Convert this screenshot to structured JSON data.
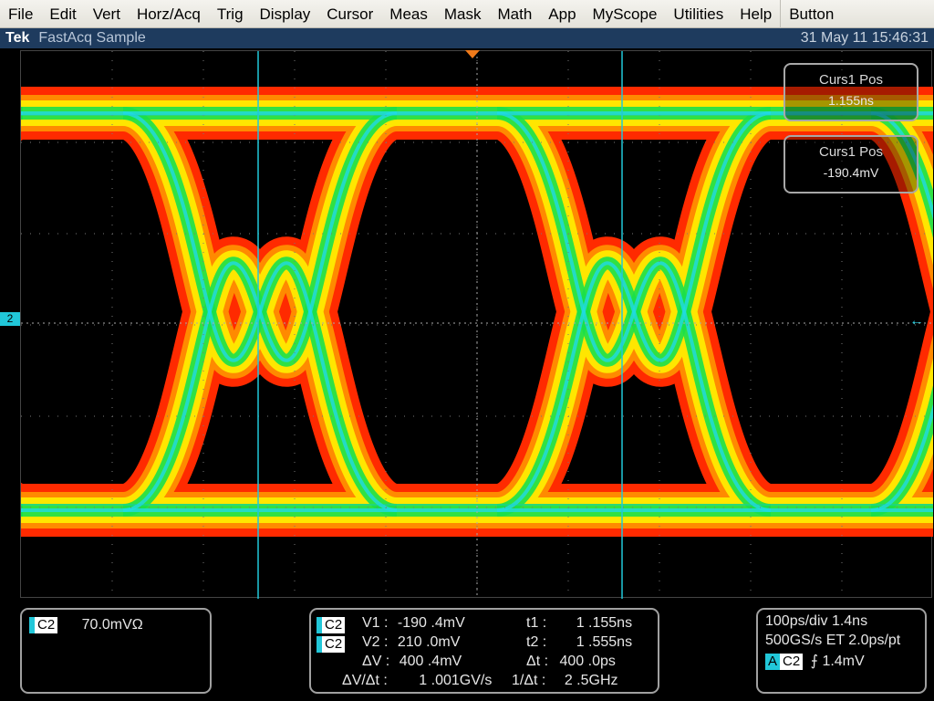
{
  "menubar": {
    "items": [
      "File",
      "Edit",
      "Vert",
      "Horz/Acq",
      "Trig",
      "Display",
      "Cursor",
      "Meas",
      "Mask",
      "Math",
      "App",
      "MyScope",
      "Utilities",
      "Help",
      "Button"
    ]
  },
  "titlebar": {
    "brand": "Tek",
    "title": "FastAcq Sample",
    "timestamp": "31 May 11 15:46:31"
  },
  "display": {
    "channel_marker": "2",
    "colors": {
      "trace_hot": "#ff2a00",
      "trace_mid": "#ffe600",
      "trace_cool": "#19e04a",
      "trace_peak": "#21d9e6",
      "cursor": "#21c7d9",
      "grid": "#777777"
    }
  },
  "cursor_readouts": {
    "pos1": {
      "label": "Curs1 Pos",
      "value": "1.155ns"
    },
    "pos2": {
      "label": "Curs1 Pos",
      "value": "-190.4mV"
    }
  },
  "channel_box": {
    "badge": "C2",
    "scale": "70.0mVΩ"
  },
  "measure_box": {
    "badge1": "C2",
    "badge2": "C2",
    "v1_label": "V1 :",
    "v1": "-190 .4mV",
    "v2_label": "V2 :",
    "v2": "210 .0mV",
    "dv_label": "ΔV :",
    "dv": "400 .4mV",
    "dvdt_label": "ΔV/Δt :",
    "dvdt": "1 .001GV/s",
    "t1_label": "t1 :",
    "t1": "1 .155ns",
    "t2_label": "t2 :",
    "t2": "1 .555ns",
    "dt_label": "Δt :",
    "dt": "400 .0ps",
    "invdt_label": "1/Δt :",
    "invdt": "2 .5GHz"
  },
  "timebase_box": {
    "line1": "100ps/div  1.4ns",
    "line2": "500GS/s ET 2.0ps/pt",
    "trig_badge_a": "A",
    "trig_badge_ch": "C2",
    "trig_level": "⨍ 1.4mV"
  }
}
